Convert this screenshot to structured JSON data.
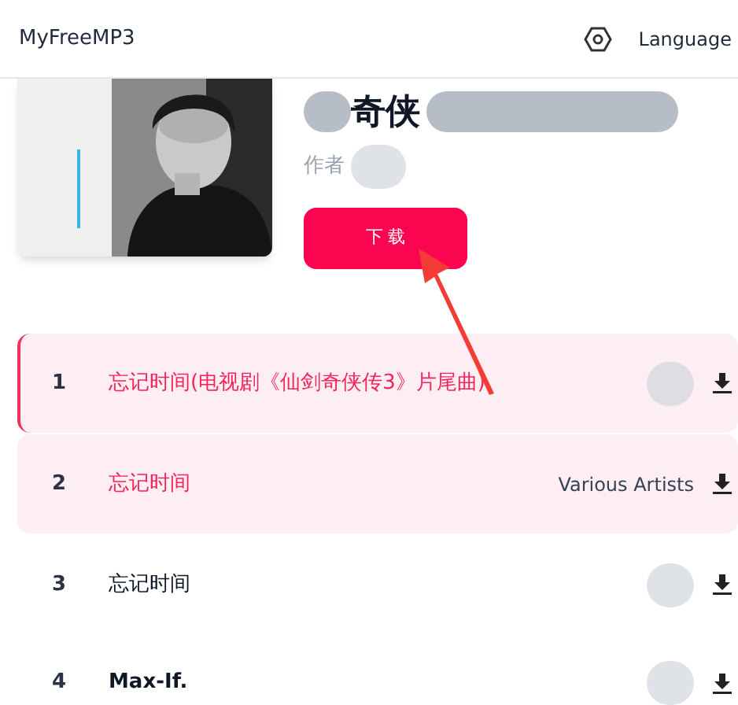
{
  "header": {
    "brand": "MyFreeMP3",
    "language": "Language"
  },
  "album": {
    "title": "奇侠",
    "author_label": "作者",
    "download_button": "下 载"
  },
  "tracks": [
    {
      "number": "1",
      "title": "忘记时间(电视剧《仙剑奇侠传3》片尾曲)",
      "selected": true,
      "highlighted": true,
      "artist_redacted": true
    },
    {
      "number": "2",
      "title": "忘记时间",
      "artist": "Various Artists",
      "selected": false,
      "highlighted": true,
      "artist_redacted": false
    },
    {
      "number": "3",
      "title": "忘记时间",
      "selected": false,
      "highlighted": false,
      "artist_redacted": true
    },
    {
      "number": "4",
      "title": "Max-If.",
      "selected": false,
      "highlighted": false,
      "artist_redacted": true
    }
  ]
}
